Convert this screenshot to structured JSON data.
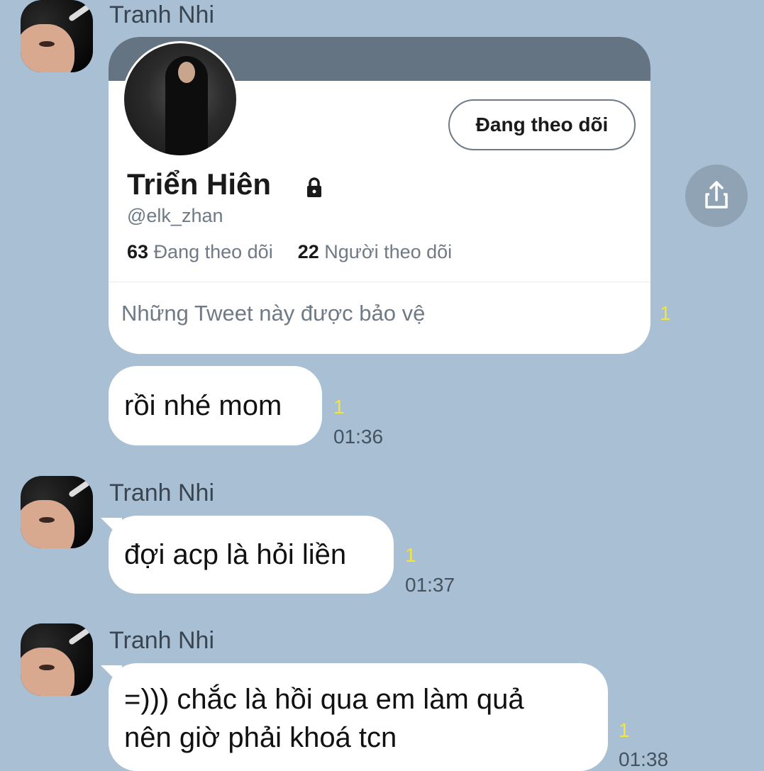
{
  "messages": [
    {
      "sender": "Tranh Nhi",
      "twitter_card": {
        "follow_button": "Đang theo dõi",
        "name": "Triển Hiên",
        "handle": "@elk_zhan",
        "following_count": "63",
        "following_label": "Đang theo dõi",
        "followers_count": "22",
        "followers_label": "Người theo dõi",
        "protected_text": "Những Tweet này được bảo vệ"
      },
      "read_count": "1"
    },
    {
      "text": "rồi nhé mom",
      "read_count": "1",
      "time": "01:36"
    },
    {
      "sender": "Tranh Nhi",
      "text": "đợi acp là hỏi liền",
      "read_count": "1",
      "time": "01:37"
    },
    {
      "sender": "Tranh Nhi",
      "text_line1": "=))) chắc là hồi qua em làm quả",
      "text_line2": "nên giờ phải khoá tcn",
      "read_count": "1",
      "time": "01:38"
    }
  ],
  "icons": {
    "share": "share-icon",
    "lock": "lock-icon"
  }
}
